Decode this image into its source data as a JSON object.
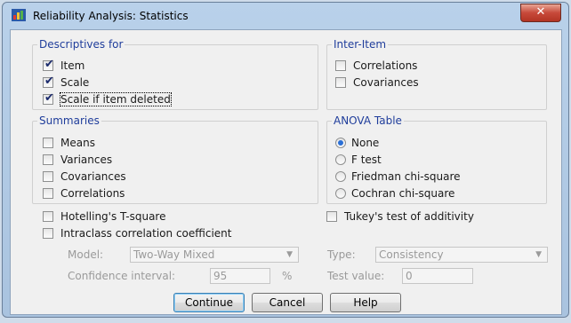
{
  "window": {
    "title": "Reliability Analysis: Statistics",
    "close_symbol": "✕"
  },
  "descriptives": {
    "legend": "Descriptives for",
    "items": [
      {
        "label": "Item",
        "checked": true
      },
      {
        "label": "Scale",
        "checked": true
      },
      {
        "label": "Scale if item deleted",
        "checked": true
      }
    ]
  },
  "inter_item": {
    "legend": "Inter-Item",
    "items": [
      {
        "label": "Correlations",
        "checked": false
      },
      {
        "label": "Covariances",
        "checked": false
      }
    ]
  },
  "summaries": {
    "legend": "Summaries",
    "items": [
      {
        "label": "Means",
        "checked": false
      },
      {
        "label": "Variances",
        "checked": false
      },
      {
        "label": "Covariances",
        "checked": false
      },
      {
        "label": "Correlations",
        "checked": false
      }
    ]
  },
  "anova": {
    "legend": "ANOVA Table",
    "options": [
      {
        "label": "None",
        "selected": true
      },
      {
        "label": "F test",
        "selected": false
      },
      {
        "label": "Friedman chi-square",
        "selected": false
      },
      {
        "label": "Cochran chi-square",
        "selected": false
      }
    ]
  },
  "hotelling": {
    "label": "Hotelling's T-square",
    "checked": false
  },
  "tukey": {
    "label": "Tukey's test of additivity",
    "checked": false
  },
  "intraclass": {
    "label": "Intraclass correlation coefficient",
    "checked": false
  },
  "model": {
    "label": "Model:",
    "value": "Two-Way Mixed"
  },
  "type": {
    "label": "Type:",
    "value": "Consistency"
  },
  "confidence": {
    "label": "Confidence interval:",
    "value": "95",
    "unit": "%"
  },
  "test_value": {
    "label": "Test value:",
    "value": "0"
  },
  "buttons": {
    "continue": "Continue",
    "cancel": "Cancel",
    "help": "Help"
  },
  "colors": {
    "legend": "#1f3d9b",
    "accent": "#3c7fb1",
    "close": "#c7493a"
  },
  "icons": {
    "checkmark": "✔",
    "dropdown": "▼"
  }
}
